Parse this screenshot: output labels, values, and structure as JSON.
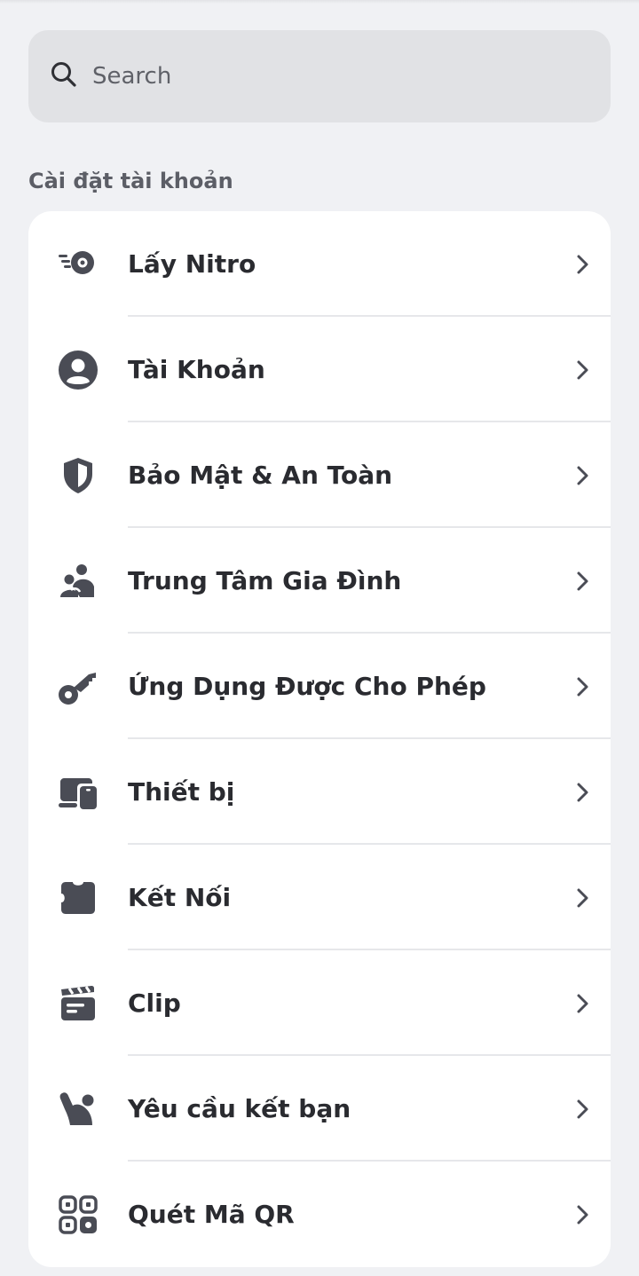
{
  "search": {
    "placeholder": "Search",
    "icon": "search-icon"
  },
  "section": {
    "title": "Cài đặt tài khoản"
  },
  "items": [
    {
      "label": "Lấy Nitro",
      "icon": "nitro-icon"
    },
    {
      "label": "Tài Khoản",
      "icon": "account-icon"
    },
    {
      "label": "Bảo Mật & An Toàn",
      "icon": "shield-icon"
    },
    {
      "label": "Trung Tâm Gia Đình",
      "icon": "family-icon"
    },
    {
      "label": "Ứng Dụng Được Cho Phép",
      "icon": "key-icon"
    },
    {
      "label": "Thiết bị",
      "icon": "devices-icon"
    },
    {
      "label": "Kết Nối",
      "icon": "puzzle-icon"
    },
    {
      "label": "Clip",
      "icon": "clapperboard-icon"
    },
    {
      "label": "Yêu cầu kết bạn",
      "icon": "wave-person-icon"
    },
    {
      "label": "Quét Mã QR",
      "icon": "qr-code-icon"
    }
  ],
  "colors": {
    "background": "#f0f1f4",
    "card": "#ffffff",
    "icon": "#4a4c55",
    "text": "#2a2b30"
  }
}
